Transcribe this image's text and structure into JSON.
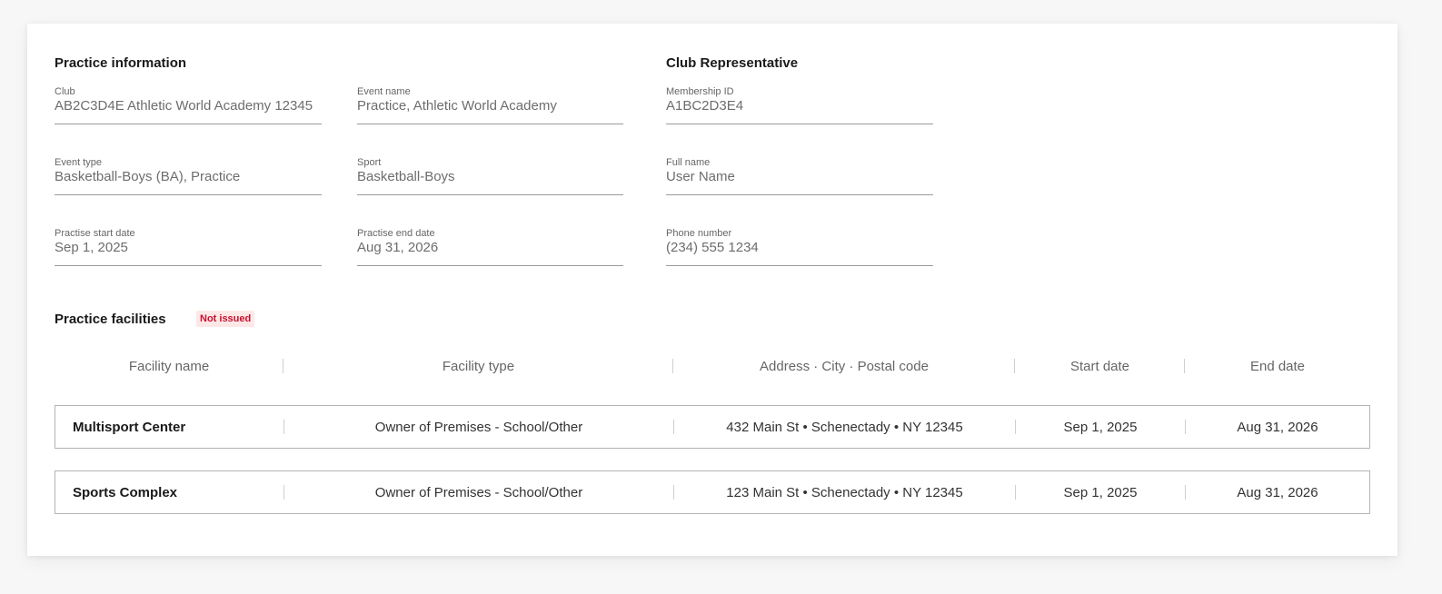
{
  "practice_info": {
    "title": "Practice information",
    "fields": {
      "club": {
        "label": "Club",
        "value": "AB2C3D4E Athletic World Academy 12345"
      },
      "event_name": {
        "label": "Event name",
        "value": "Practice, Athletic World Academy"
      },
      "event_type": {
        "label": "Event type",
        "value": "Basketball-Boys (BA), Practice"
      },
      "sport": {
        "label": "Sport",
        "value": "Basketball-Boys"
      },
      "start_date": {
        "label": "Practise start date",
        "value": "Sep 1, 2025"
      },
      "end_date": {
        "label": "Practise end date",
        "value": "Aug 31, 2026"
      }
    }
  },
  "club_rep": {
    "title": "Club Representative",
    "fields": {
      "membership_id": {
        "label": "Membership ID",
        "value": "A1BC2D3E4"
      },
      "full_name": {
        "label": "Full name",
        "value": "User Name"
      },
      "phone": {
        "label": "Phone number",
        "value": "(234) 555 1234"
      }
    }
  },
  "facilities": {
    "title": "Practice facilities",
    "status_badge": "Not issued",
    "status_color": "#c8102e",
    "columns": [
      "Facility name",
      "Facility type",
      "Address · City · Postal code",
      "Start date",
      "End date"
    ],
    "rows": [
      [
        "Multisport Center",
        "Owner of Premises - School/Other",
        "432 Main St • Schenectady • NY 12345",
        "Sep 1, 2025",
        "Aug 31, 2026"
      ],
      [
        "Sports Complex",
        "Owner of Premises - School/Other",
        "123 Main St • Schenectady • NY 12345",
        "Sep 1, 2025",
        "Aug 31, 2026"
      ]
    ]
  }
}
